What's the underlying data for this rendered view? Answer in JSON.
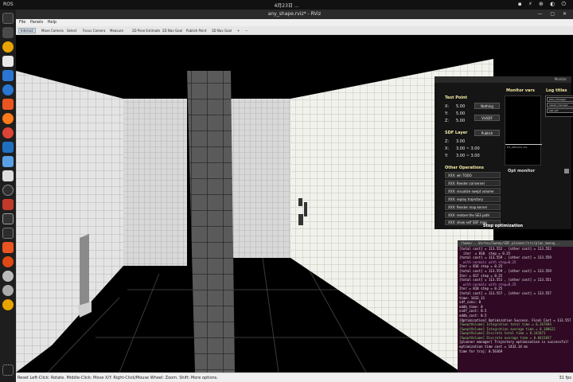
{
  "system": {
    "activities": "ROS",
    "clock": "4月23日 ...",
    "tray": "▪ ⚡ ⊕ ◐ ⏻"
  },
  "window": {
    "title": "any_shape.rviz* - RViz",
    "controls": "— ▢ ✕"
  },
  "menu": [
    "File",
    "Panels",
    "Help"
  ],
  "toolbar": [
    {
      "label": "Interact",
      "active": true
    },
    {
      "label": "Move Camera"
    },
    {
      "label": "Select"
    },
    {
      "label": "Focus Camera"
    },
    {
      "label": "Measure"
    },
    {
      "label": "2D Pose Estimate"
    },
    {
      "label": "2D Nav Goal"
    },
    {
      "label": "Publish Point"
    },
    {
      "label": "3D Nav Goal"
    },
    {
      "label": "+"
    },
    {
      "label": "−"
    }
  ],
  "gui": {
    "header": "Monitor",
    "test_point": {
      "title": "Test Point",
      "x": "X:",
      "x_val": "5.00",
      "y": "Y:",
      "y_val": "5.00",
      "z": "Z:",
      "z_val": "5.00",
      "btn_nothing": "Nothing",
      "btn_vissdf": "VisSDF"
    },
    "sdf_layer": {
      "title": "SDF Layer",
      "btn_publish": "Publish",
      "z": "Z:",
      "z_val": "3.00",
      "x": "X:",
      "x_val": "3.00 ~ 3.00",
      "y": "Y:",
      "y_val": "3.00 ~ 3.00"
    },
    "other_ops": {
      "title": "Other Operations",
      "items": [
        "XXX: wh TODO",
        "XXX: Render col kernel",
        "XXX: visualize swept volume",
        "XXX: replay trajectory",
        "XXX: Render map kernel",
        "XXX: restore the SE3 path",
        "XXX: show self SDF map"
      ]
    },
    "monitor_vars": "Monitor vars",
    "plot_label": "tot_sdfxxxxx.xxx",
    "opt_monitor": "Opt monitor",
    "log_titles": "Log titles",
    "log_items": [
      "plan_manager",
      "swept_manager",
      "self_sdf"
    ],
    "stop_label": "Stop optimization"
  },
  "terminal": {
    "title": "/home/...Vertex/Sweep/SDF_planner/src/plan_manag...",
    "lines": [
      {
        "t": "[total cost] = 113.552 , [other cost] = 113.552",
        "c": ""
      },
      {
        "t": "  iter  = 810  step = 0.25",
        "c": ""
      },
      {
        "t": "[total cost] = 113.559 , [other cost] = 113.559",
        "c": ""
      },
      {
        "t": "  with normals with step=0.25",
        "c": "c-purple"
      },
      {
        "t": "Iter = 816 step = 0.25",
        "c": ""
      },
      {
        "t": "[total cost] = 113.559 , [other cost] = 113.559",
        "c": ""
      },
      {
        "t": "Iter = 817 step = 0.25",
        "c": ""
      },
      {
        "t": "[total cost] = 113.551 , [other cost] = 113.551",
        "c": ""
      },
      {
        "t": "  with normals with step=0.25",
        "c": "c-purple"
      },
      {
        "t": "Iter = 818 step = 0.25",
        "c": ""
      },
      {
        "t": "[total cost] = 113.557 , [other cost] = 113.557",
        "c": ""
      },
      {
        "t": "time: 1432.11",
        "c": ""
      },
      {
        "t": "sdf_cons: 0",
        "c": ""
      },
      {
        "t": "oddb_time: 0",
        "c": ""
      },
      {
        "t": "ssdf_cost: 0.5",
        "c": ""
      },
      {
        "t": "oddb_cost: 0.5",
        "c": ""
      },
      {
        "t": "[Optimization] Optimization Success. Final Cost = 113.557",
        "c": ""
      },
      {
        "t": "[SweptVolume] Integration total time = 0.367694",
        "c": "c-green"
      },
      {
        "t": "[SweptVolume] Integration average time = 0.108622",
        "c": "c-green"
      },
      {
        "t": "[SweptVolume] Discrete total time = 0.141071",
        "c": "c-green"
      },
      {
        "t": "[SweptVolume] Discrete average time = 0.0431037",
        "c": "c-green"
      },
      {
        "t": "[planner manager] Trajectory optimization is successful!",
        "c": ""
      },
      {
        "t": "optimization time cost = 1432.14 ms",
        "c": ""
      },
      {
        "t": "time for traj: 0.56369",
        "c": ""
      }
    ]
  },
  "status": {
    "left": "Reset  Left-Click: Rotate. Middle-Click: Move X/Y. Right-Click/Mouse Wheel: Zoom. Shift: More options.",
    "fps": "31 fps"
  },
  "colors": {
    "gui_bg": "#151515",
    "section": "#f3e8a6",
    "terminal_bg": "#300a24"
  }
}
